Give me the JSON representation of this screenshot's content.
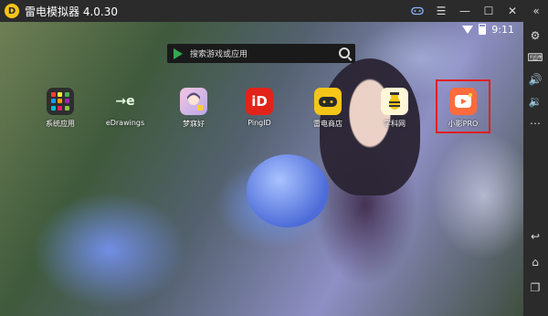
{
  "window": {
    "title": "雷电模拟器 4.0.30",
    "logo_letter": "D",
    "buttons": [
      "gamepad-icon",
      "menu-icon",
      "minimize-icon",
      "maximize-icon",
      "close-icon",
      "collapse-icon"
    ]
  },
  "status_bar": {
    "time": "9:11"
  },
  "search": {
    "placeholder": "搜索游戏或应用"
  },
  "apps": [
    {
      "label": "系统应用"
    },
    {
      "label": "eDrawings",
      "glyph": "→e"
    },
    {
      "label": "梦寐好"
    },
    {
      "label": "PingID",
      "glyph": "iD"
    },
    {
      "label": "雷电商店"
    },
    {
      "label": "学科网"
    },
    {
      "label": "小影PRO"
    }
  ],
  "colors": {
    "titlebar": "#2b2b2b",
    "highlight": "#e02020",
    "pingid": "#e2231a",
    "store": "#f5c518",
    "xiaoying": "#ff6b3d"
  }
}
